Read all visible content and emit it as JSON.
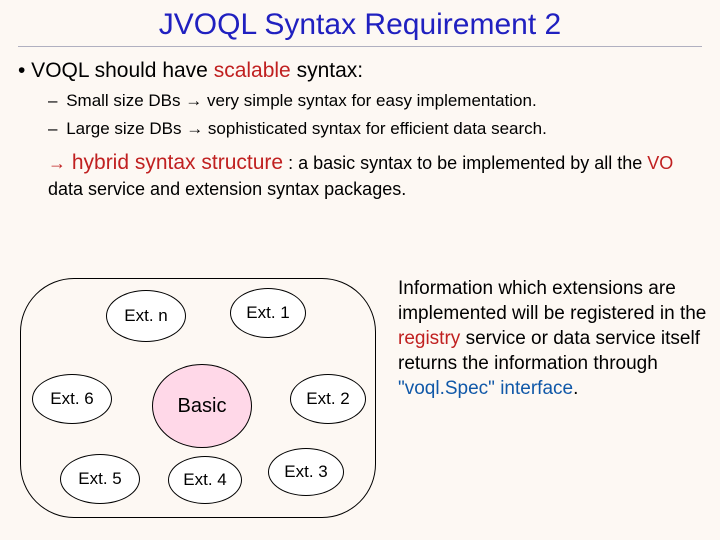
{
  "title": "JVOQL Syntax Requirement 2",
  "main_bullet_pre": "• VOQL should have ",
  "main_bullet_kw": "scalable",
  "main_bullet_post": " syntax:",
  "sub1_dash": "–",
  "sub1_a": " Small size DBs ",
  "sub1_arrow": "→",
  "sub1_b": " very simple syntax for easy implementation.",
  "sub2_dash": "–",
  "sub2_a": " Large size DBs ",
  "sub2_arrow": "→",
  "sub2_b": " sophisticated syntax for efficient data search.",
  "hyb_arrow": "→",
  "hyb_kw": " hybrid syntax structure",
  "hyb_mid": " : a basic syntax to be implemented by all the ",
  "hyb_vo": "VO",
  "hyb_post": " data service and extension syntax packages.",
  "diagram": {
    "extn": "Ext. n",
    "ext1": "Ext. 1",
    "ext2": "Ext. 2",
    "ext3": "Ext. 3",
    "ext4": "Ext. 4",
    "ext5": "Ext. 5",
    "ext6": "Ext. 6",
    "basic": "Basic"
  },
  "info_a": "Information which extensions are implemented will be registered in the ",
  "info_registry": "registry",
  "info_b": " service or data service itself returns the information through ",
  "info_voqlspec": "\"voql.Spec\" interface",
  "info_c": "."
}
